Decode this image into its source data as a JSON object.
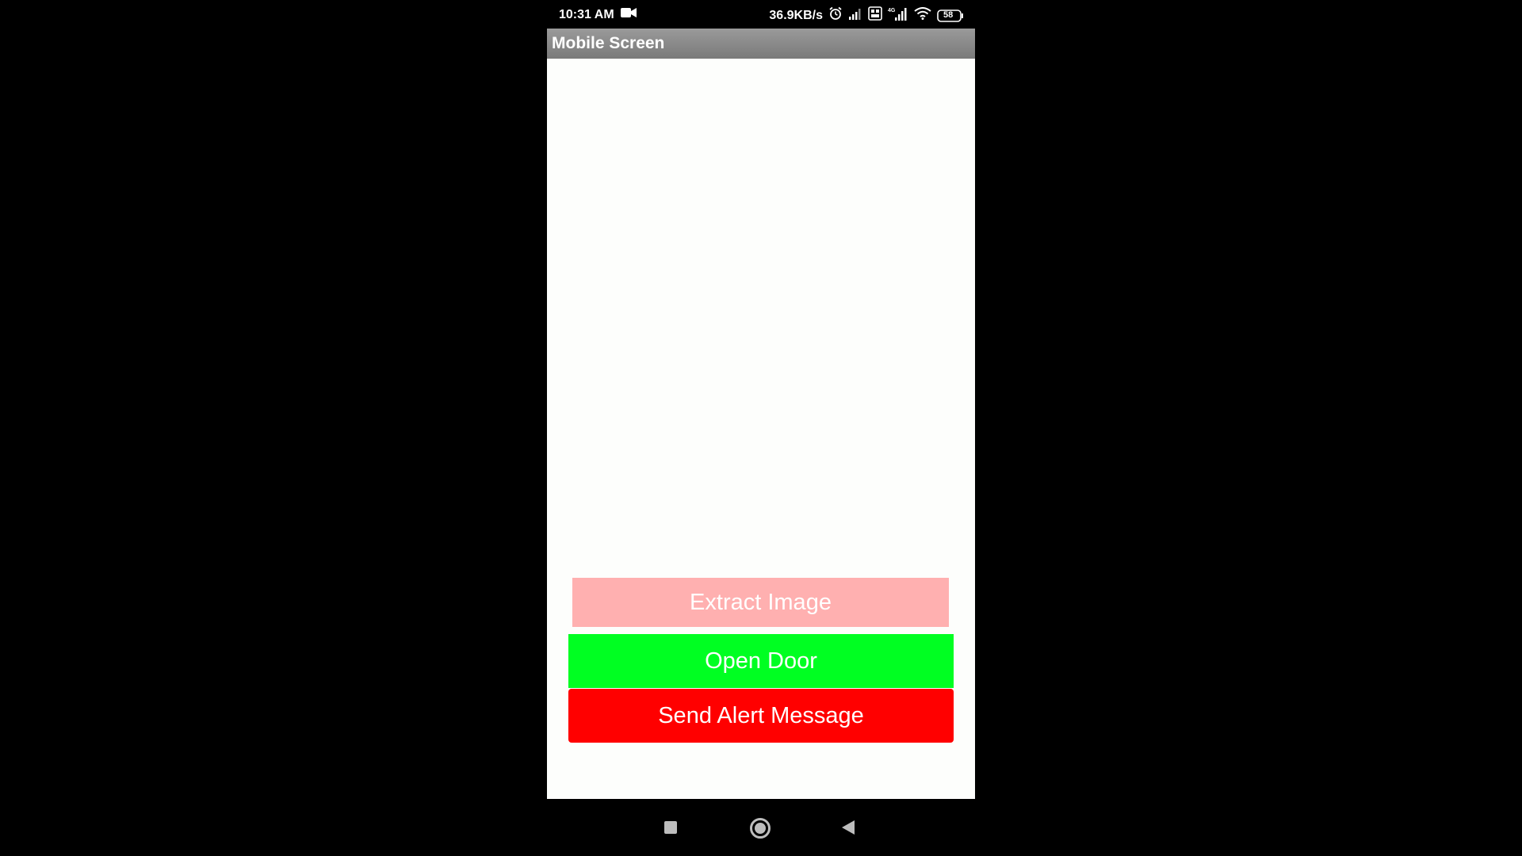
{
  "status_bar": {
    "time": "10:31 AM",
    "network_speed": "36.9KB/s",
    "battery_level": "58",
    "icons": [
      "video-camera-icon",
      "alarm-icon",
      "signal-icon",
      "volte-icon",
      "4g-signal-icon",
      "wifi-icon",
      "battery-icon"
    ]
  },
  "app": {
    "title": "Mobile Screen"
  },
  "buttons": {
    "extract_image": "Extract Image",
    "open_door": "Open Door",
    "send_alert": "Send Alert Message"
  },
  "colors": {
    "extract_button": "#ffb0b0",
    "open_button": "#00ff22",
    "alert_button": "#ff0000",
    "title_bar": "#8a8a8a",
    "background": "#000000"
  },
  "nav_bar": {
    "icons": [
      "recent-apps-icon",
      "home-icon",
      "back-icon"
    ]
  }
}
